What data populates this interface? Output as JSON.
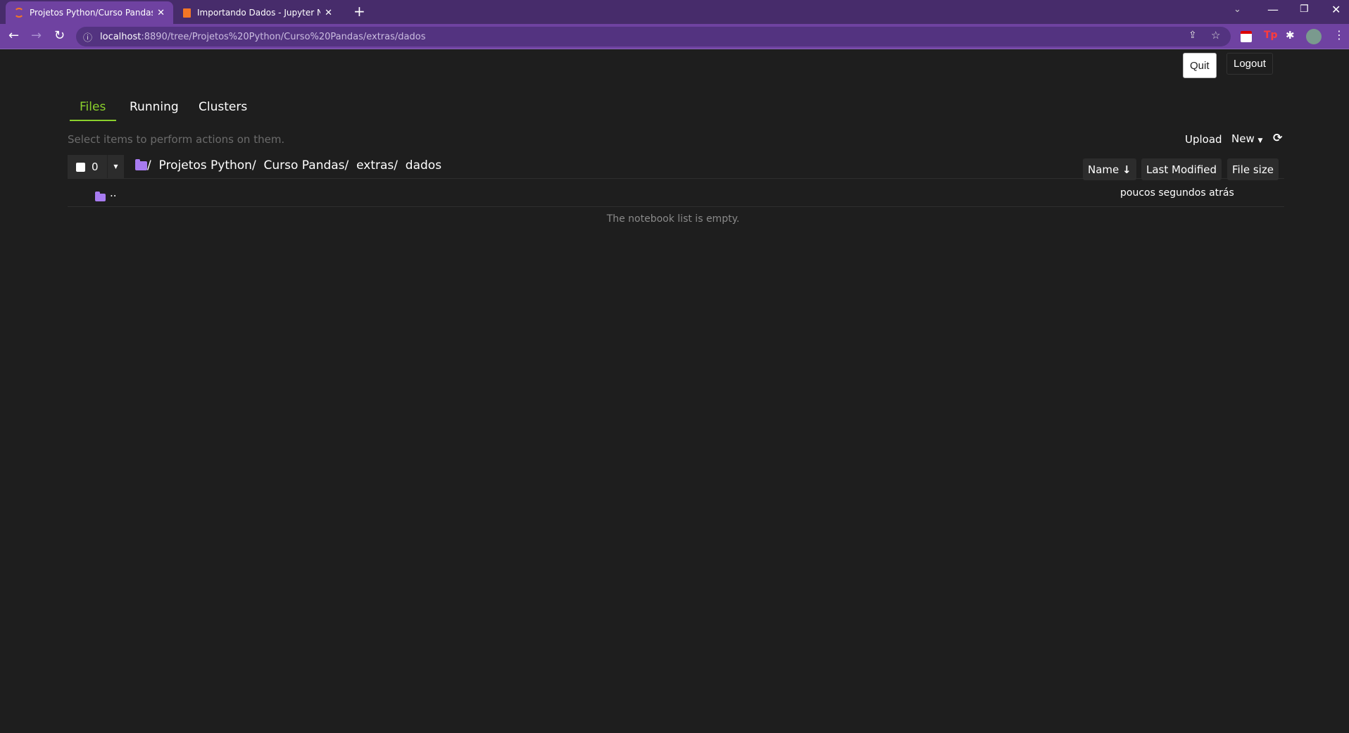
{
  "browser": {
    "tabs": [
      {
        "title": "Projetos Python/Curso Pandas/ex",
        "active": true
      },
      {
        "title": "Importando Dados - Jupyter Note",
        "active": false
      }
    ],
    "url_host": "localhost",
    "url_rest": ":8890/tree/Projetos%20Python/Curso%20Pandas/extras/dados",
    "colors": {
      "frame": "#472c6b",
      "toolbar": "#6f42a1"
    }
  },
  "header": {
    "quit": "Quit",
    "logout": "Logout"
  },
  "nav_tabs": [
    {
      "label": "Files",
      "active": true
    },
    {
      "label": "Running"
    },
    {
      "label": "Clusters"
    }
  ],
  "toolbar": {
    "hint": "Select items to perform actions on them.",
    "upload": "Upload",
    "new": "New",
    "selected_count": "0"
  },
  "breadcrumb": [
    "/",
    "Projetos Python/",
    "Curso Pandas/",
    "extras/",
    "dados"
  ],
  "columns": {
    "name": "Name",
    "last_modified": "Last Modified",
    "file_size": "File size"
  },
  "rows": [
    {
      "name": "..",
      "modified": "poucos segundos atrás"
    }
  ],
  "empty_message": "The notebook list is empty.",
  "accent": "#8bd12c"
}
